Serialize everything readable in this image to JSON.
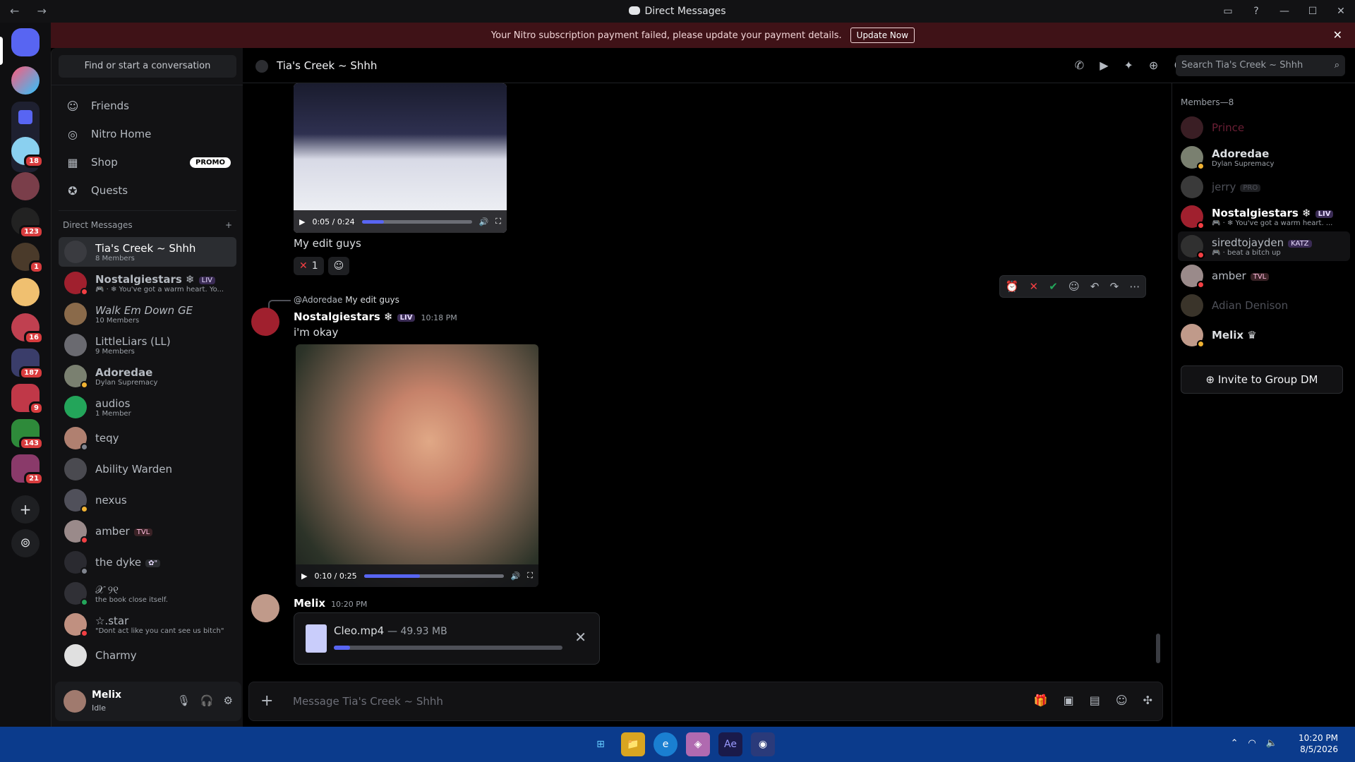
{
  "window": {
    "title": "Direct Messages",
    "nav": "← →",
    "controls": [
      "▭",
      "?",
      "—",
      "☐",
      "✕"
    ]
  },
  "banner": {
    "text": "Your Nitro subscription payment failed, please update your payment details.",
    "button": "Update Now",
    "close": "✕"
  },
  "guilds": {
    "badges": [
      "18",
      "123",
      "1",
      "16",
      "187",
      "9",
      "143",
      "21"
    ],
    "add": "+",
    "discover": "⊚"
  },
  "sidebar": {
    "find": "Find or start a conversation",
    "nav": [
      {
        "label": "Friends",
        "icon": "friends-icon"
      },
      {
        "label": "Nitro Home",
        "icon": "nitro-icon"
      },
      {
        "label": "Shop",
        "icon": "shop-icon",
        "badge": "PROMO"
      },
      {
        "label": "Quests",
        "icon": "quests-icon"
      }
    ],
    "dm_header": "Direct Messages",
    "dm_add": "+",
    "dms": [
      {
        "name": "Tia's Creek ~ Shhh",
        "sub": "8 Members",
        "active": true
      },
      {
        "name": "Nostalgiestars ❄",
        "tag": "LIV",
        "sub": "🎮 · ❄ You've got a warm heart. Yo..."
      },
      {
        "name": "Walk Em Down GE",
        "sub": "10 Members"
      },
      {
        "name": "LittleLiars (LL)",
        "sub": "9 Members"
      },
      {
        "name": "Adoredae",
        "sub": "Dylan Supremacy"
      },
      {
        "name": "audios",
        "sub": "1 Member"
      },
      {
        "name": "teqy",
        "sub": ""
      },
      {
        "name": "Ability Warden",
        "sub": ""
      },
      {
        "name": "nexus",
        "sub": ""
      },
      {
        "name": "amber",
        "tag": "TVL",
        "sub": ""
      },
      {
        "name": "the dyke",
        "tag": "✿\"",
        "sub": ""
      },
      {
        "name": "𝒳 ୨୧",
        "sub": "the book close itself."
      },
      {
        "name": "☆.star",
        "sub": "\"Dont act like you cant see us bitch\""
      },
      {
        "name": "Charmy",
        "sub": ""
      }
    ]
  },
  "user": {
    "name": "Melix",
    "status": "Idle"
  },
  "chat": {
    "channel": "Tia's Creek ~ Shhh",
    "search_placeholder": "Search Tia's Creek ~ Shhh",
    "video1": {
      "time": "0:05 / 0:24",
      "progress": 0.2
    },
    "msg1": "My edit guys",
    "reaction": {
      "emoji": "✕",
      "count": "1"
    },
    "reply_ref": {
      "user": "@Adoredae",
      "text": "My edit guys"
    },
    "msg2": {
      "author": "Nostalgiestars ❄",
      "tag": "LIV",
      "time": "10:18 PM",
      "text": "i'm okay"
    },
    "video2": {
      "time": "0:10 / 0:25",
      "progress": 0.4
    },
    "msg3": {
      "author": "Melix",
      "time": "10:20 PM"
    },
    "upload": {
      "file": "Cleo.mp4",
      "size": "— 49.93 MB",
      "progress": 0.07
    },
    "composer_placeholder": "Message Tia's Creek ~ Shhh"
  },
  "members": {
    "header": "Members—8",
    "list": [
      {
        "name": "Prince",
        "sub": "",
        "color": "#6b1f35"
      },
      {
        "name": "Adoredae",
        "sub": "Dylan Supremacy"
      },
      {
        "name": "jerry",
        "tag": "PRO",
        "sub": ""
      },
      {
        "name": "Nostalgiestars ❄",
        "tag": "LIV",
        "sub": "🎮 · ❄ You've got a warm heart. ..."
      },
      {
        "name": "siredtojayden",
        "tag": "KATZ",
        "sub": "🎮 · beat a bitch up"
      },
      {
        "name": "amber",
        "tag": "TVL",
        "sub": ""
      },
      {
        "name": "Adian Denison",
        "sub": ""
      },
      {
        "name": "Melix ♛",
        "sub": ""
      }
    ],
    "invite": "Invite to Group DM"
  },
  "taskbar": {
    "time": "10:20 PM",
    "date": "8/5/2026",
    "apps": [
      "⊞",
      "📁",
      "e",
      "◈",
      "Ae",
      "◉"
    ]
  }
}
